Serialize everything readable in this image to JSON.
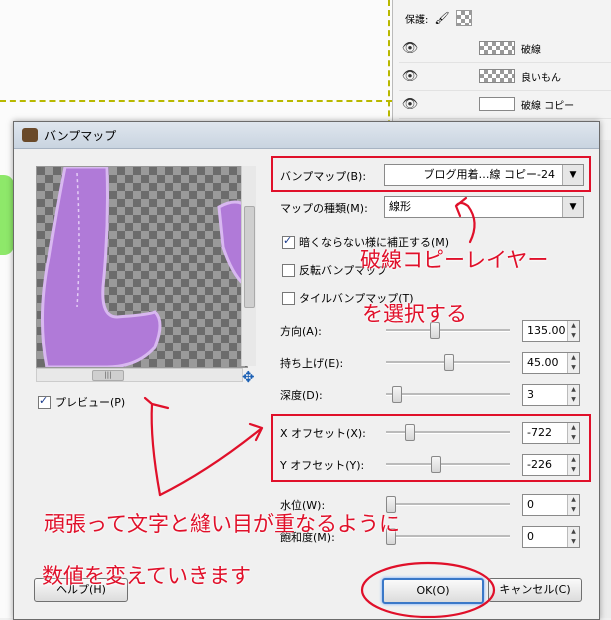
{
  "layers_panel": {
    "lock_label": "保護:",
    "layers": [
      {
        "name": "破線",
        "thumb": "checker"
      },
      {
        "name": "良いもん",
        "thumb": "checker"
      },
      {
        "name": "破線 コピー",
        "thumb": "white"
      }
    ]
  },
  "dialog": {
    "title": "バンプマップ",
    "preview_label": "プレビュー(P)",
    "bumpmap_label": "バンプマップ(B):",
    "bumpmap_value": "ブログ用着…線 コピー-24",
    "maptype_label": "マップの種類(M):",
    "maptype_value": "線形",
    "compensate_label": "暗くならない様に補正する(M)",
    "invert_label": "反転バンプマップ",
    "tile_label": "タイルバンプマップ(T)",
    "params": [
      {
        "label": "方向(A):",
        "value": "135.00",
        "pos": 0.38
      },
      {
        "label": "持ち上げ(E):",
        "value": "45.00",
        "pos": 0.5
      },
      {
        "label": "深度(D):",
        "value": "3",
        "pos": 0.05
      },
      {
        "label": "X オフセット(X):",
        "value": "-722",
        "pos": 0.16
      },
      {
        "label": "Y オフセット(Y):",
        "value": "-226",
        "pos": 0.39
      },
      {
        "label": "水位(W):",
        "value": "0",
        "pos": 0.0
      },
      {
        "label": "飽和度(M):",
        "value": "0",
        "pos": 0.0
      }
    ],
    "help_label": "ヘルプ(H)",
    "ok_label": "OK(O)",
    "cancel_label": "キャンセル(C)"
  },
  "annotations": {
    "select_line1": "破線コピーレイヤー",
    "select_line2": "を選択する",
    "adjust_line1": "頑張って文字と縫い目が重なるように",
    "adjust_line2": "数値を変えていきます",
    "color": "#e0102a"
  }
}
